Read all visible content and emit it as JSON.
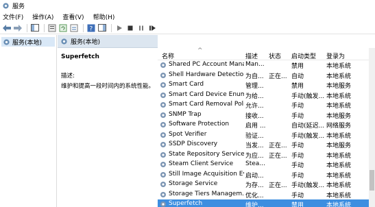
{
  "window": {
    "title": "服务"
  },
  "menu": [
    "文件(F)",
    "操作(A)",
    "查看(V)",
    "帮助(H)"
  ],
  "tree": {
    "selected": "服务(本地)"
  },
  "panel": {
    "header": "服务(本地)"
  },
  "details": {
    "service_name": "Superfetch",
    "desc_label": "描述:",
    "desc_text": "维护和提高一段时间内的系统性能。"
  },
  "table": {
    "columns": [
      "名称",
      "描述",
      "状态",
      "启动类型",
      "登录为"
    ],
    "rows": [
      [
        "Shared PC Account Mana...",
        "Man...",
        "",
        "禁用",
        "本地系统"
      ],
      [
        "Shell Hardware Detection",
        "为自...",
        "正在...",
        "自动",
        "本地系统"
      ],
      [
        "Smart Card",
        "管理...",
        "",
        "禁用",
        "本地服务"
      ],
      [
        "Smart Card Device Enum...",
        "为给...",
        "",
        "手动(触发...",
        "本地系统"
      ],
      [
        "Smart Card Removal Poli...",
        "允许...",
        "",
        "手动",
        "本地系统"
      ],
      [
        "SNMP Trap",
        "接收...",
        "",
        "手动",
        "本地服务"
      ],
      [
        "Software Protection",
        "启用 ...",
        "",
        "自动(延迟...",
        "网络服务"
      ],
      [
        "Spot Verifier",
        "验证...",
        "",
        "手动(触发...",
        "本地系统"
      ],
      [
        "SSDP Discovery",
        "当发...",
        "正在...",
        "手动",
        "本地服务"
      ],
      [
        "State Repository Service",
        "为应...",
        "正在...",
        "手动",
        "本地系统"
      ],
      [
        "Steam Client Service",
        "Stea...",
        "",
        "手动",
        "本地系统"
      ],
      [
        "Still Image Acquisition Ev...",
        "启动...",
        "",
        "手动",
        "本地系统"
      ],
      [
        "Storage Service",
        "为存...",
        "正在...",
        "手动(触发...",
        "本地系统"
      ],
      [
        "Storage Tiers Managem...",
        "优化...",
        "",
        "手动",
        "本地系统"
      ],
      [
        "Superfetch",
        "维护...",
        "",
        "禁用",
        "本地系统"
      ]
    ],
    "selected_index": 14
  },
  "colors": {
    "selection": "#3d8ee0",
    "header_band": "#dce6f0"
  }
}
